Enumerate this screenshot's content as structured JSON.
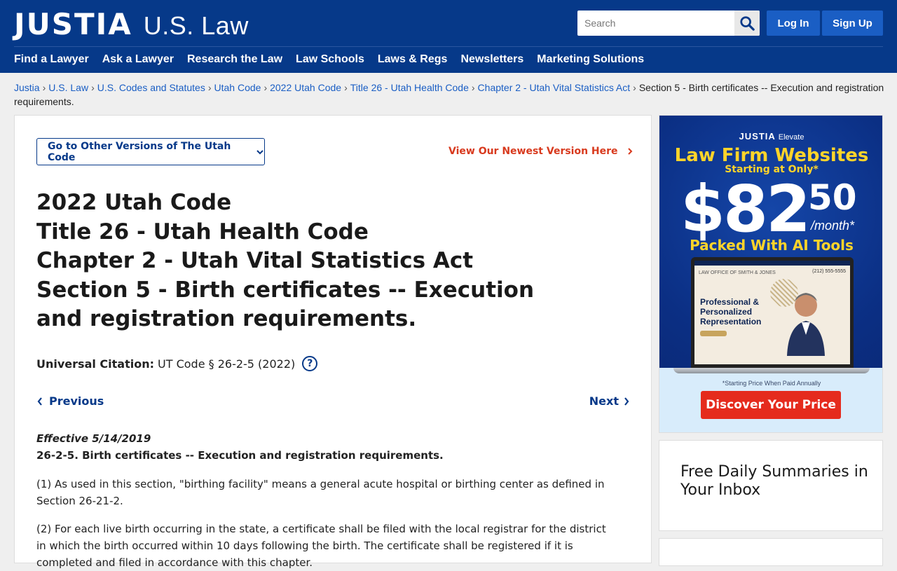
{
  "header": {
    "logo_main": "JUSTIA",
    "logo_sub": "U.S. Law",
    "search_placeholder": "Search",
    "login_label": "Log In",
    "signup_label": "Sign Up",
    "nav": [
      "Find a Lawyer",
      "Ask a Lawyer",
      "Research the Law",
      "Law Schools",
      "Laws & Regs",
      "Newsletters",
      "Marketing Solutions"
    ]
  },
  "breadcrumb": {
    "links": [
      "Justia",
      "U.S. Law",
      "U.S. Codes and Statutes",
      "Utah Code",
      "2022 Utah Code",
      "Title 26 - Utah Health Code",
      "Chapter 2 - Utah Vital Statistics Act"
    ],
    "current": "Section 5 - Birth certificates -- Execution and registration requirements."
  },
  "main": {
    "versions_button": "Go to Other Versions of The Utah Code",
    "newest_link": "View Our Newest Version Here",
    "title_lines": [
      "2022 Utah Code",
      "Title 26 - Utah Health Code",
      "Chapter 2 - Utah Vital Statistics Act",
      "Section 5 - Birth certificates -- Execution and registration requirements."
    ],
    "citation_label": "Universal Citation:",
    "citation_value": "UT Code § 26-2-5 (2022)",
    "help": "?",
    "previous": "Previous",
    "next": "Next",
    "effective": "Effective 5/14/2019",
    "section_heading": "26-2-5. Birth certificates -- Execution and registration requirements.",
    "para1": "(1) As used in this section, \"birthing facility\" means a general acute hospital or birthing center as defined in Section 26-21-2.",
    "para2": "(2) For each live birth occurring in the state, a certificate shall be filed with the local registrar for the district in which the birth occurred within 10 days following the birth. The certificate shall be registered if it is completed and filed in accordance with this chapter."
  },
  "ad": {
    "brand": "JUSTIA",
    "brand_sub": "Elevate",
    "title": "Law Firm Websites",
    "starting": "Starting at Only*",
    "price": "$82",
    "cents": "50",
    "per_month": "/month*",
    "tools": "Packed With AI Tools",
    "screen_firm": "LAW OFFICE OF SMITH & JONES",
    "screen_phone": "(212) 555-5555",
    "screen_headline": "Professional & Personalized Representation",
    "note": "*Starting Price When Paid Annually",
    "cta": "Discover Your Price"
  },
  "newsletter": {
    "title": "Free Daily Summaries in Your Inbox"
  },
  "colors": {
    "header_bg": "#063989",
    "link": "#1a5ec4",
    "accent_red": "#d83a1e",
    "ad_yellow": "#ffd42a"
  }
}
